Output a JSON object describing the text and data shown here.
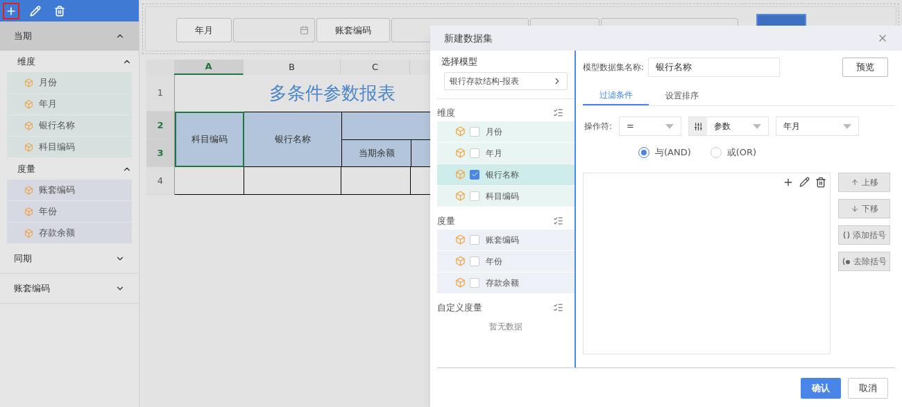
{
  "sidebar": {
    "toolbar": [
      {
        "kind": "add",
        "highlighted": true
      },
      {
        "kind": "edit",
        "highlighted": false
      },
      {
        "kind": "delete",
        "highlighted": false
      }
    ],
    "sections": [
      {
        "title": "当期",
        "expanded": true,
        "groups": [
          {
            "title": "维度",
            "kind": "dimension",
            "expanded": true,
            "items": [
              "月份",
              "年月",
              "银行名称",
              "科目编码"
            ]
          },
          {
            "title": "度量",
            "kind": "measure",
            "expanded": true,
            "items": [
              "账套编码",
              "年份",
              "存款余额"
            ]
          }
        ]
      },
      {
        "title": "同期",
        "expanded": false
      },
      {
        "title": "账套编码",
        "expanded": false
      }
    ]
  },
  "params": [
    {
      "kind": "label",
      "text": "年月"
    },
    {
      "kind": "date"
    },
    {
      "kind": "label",
      "text": "账套编码"
    },
    {
      "kind": "field"
    },
    {
      "kind": "label_hidden"
    },
    {
      "kind": "field"
    },
    {
      "kind": "primary"
    }
  ],
  "sheet": {
    "columns": [
      {
        "label": "A",
        "selected": true
      },
      {
        "label": "B",
        "selected": false
      },
      {
        "label": "C",
        "selected": false
      }
    ],
    "rows": [
      {
        "label": "1",
        "selected": false
      },
      {
        "label": "2",
        "selected": true
      },
      {
        "label": "3",
        "selected": true
      },
      {
        "label": "4",
        "selected": false
      }
    ],
    "title": "多条件参数报表",
    "headers": [
      "科目编码",
      "银行名称",
      "当期余额"
    ]
  },
  "dialog": {
    "title": "新建数据集",
    "model_label": "选择模型",
    "model_value": "银行存款结构-报表",
    "groups": [
      {
        "title": "维度",
        "color": "#e9f5f3",
        "items": [
          {
            "label": "月份",
            "checked": false
          },
          {
            "label": "年月",
            "checked": false
          },
          {
            "label": "银行名称",
            "checked": true
          },
          {
            "label": "科目编码",
            "checked": false
          }
        ]
      },
      {
        "title": "度量",
        "color": "#edf0f7",
        "items": [
          {
            "label": "账套编码",
            "checked": false
          },
          {
            "label": "年份",
            "checked": false
          },
          {
            "label": "存款余额",
            "checked": false
          }
        ]
      }
    ],
    "custom_title": "自定义度量",
    "custom_empty": "暂无数据",
    "name_label": "模型数据集名称:",
    "name_value": "银行名称",
    "preview": "预览",
    "tabs": [
      {
        "label": "过滤条件",
        "selected": true
      },
      {
        "label": "设置排序",
        "selected": false
      }
    ],
    "operator_label": "操作符:",
    "operator": "=",
    "source": "参数",
    "target": "年月",
    "radios": [
      {
        "label": "与(AND)",
        "selected": true
      },
      {
        "label": "或(OR)",
        "selected": false
      }
    ],
    "side_buttons": [
      {
        "kind": "up",
        "label": "上移"
      },
      {
        "kind": "down",
        "label": "下移"
      },
      {
        "kind": "add_paren",
        "label": "添加括号"
      },
      {
        "kind": "remove_paren",
        "label": "去除括号"
      }
    ],
    "confirm": "确认",
    "cancel": "取消"
  }
}
